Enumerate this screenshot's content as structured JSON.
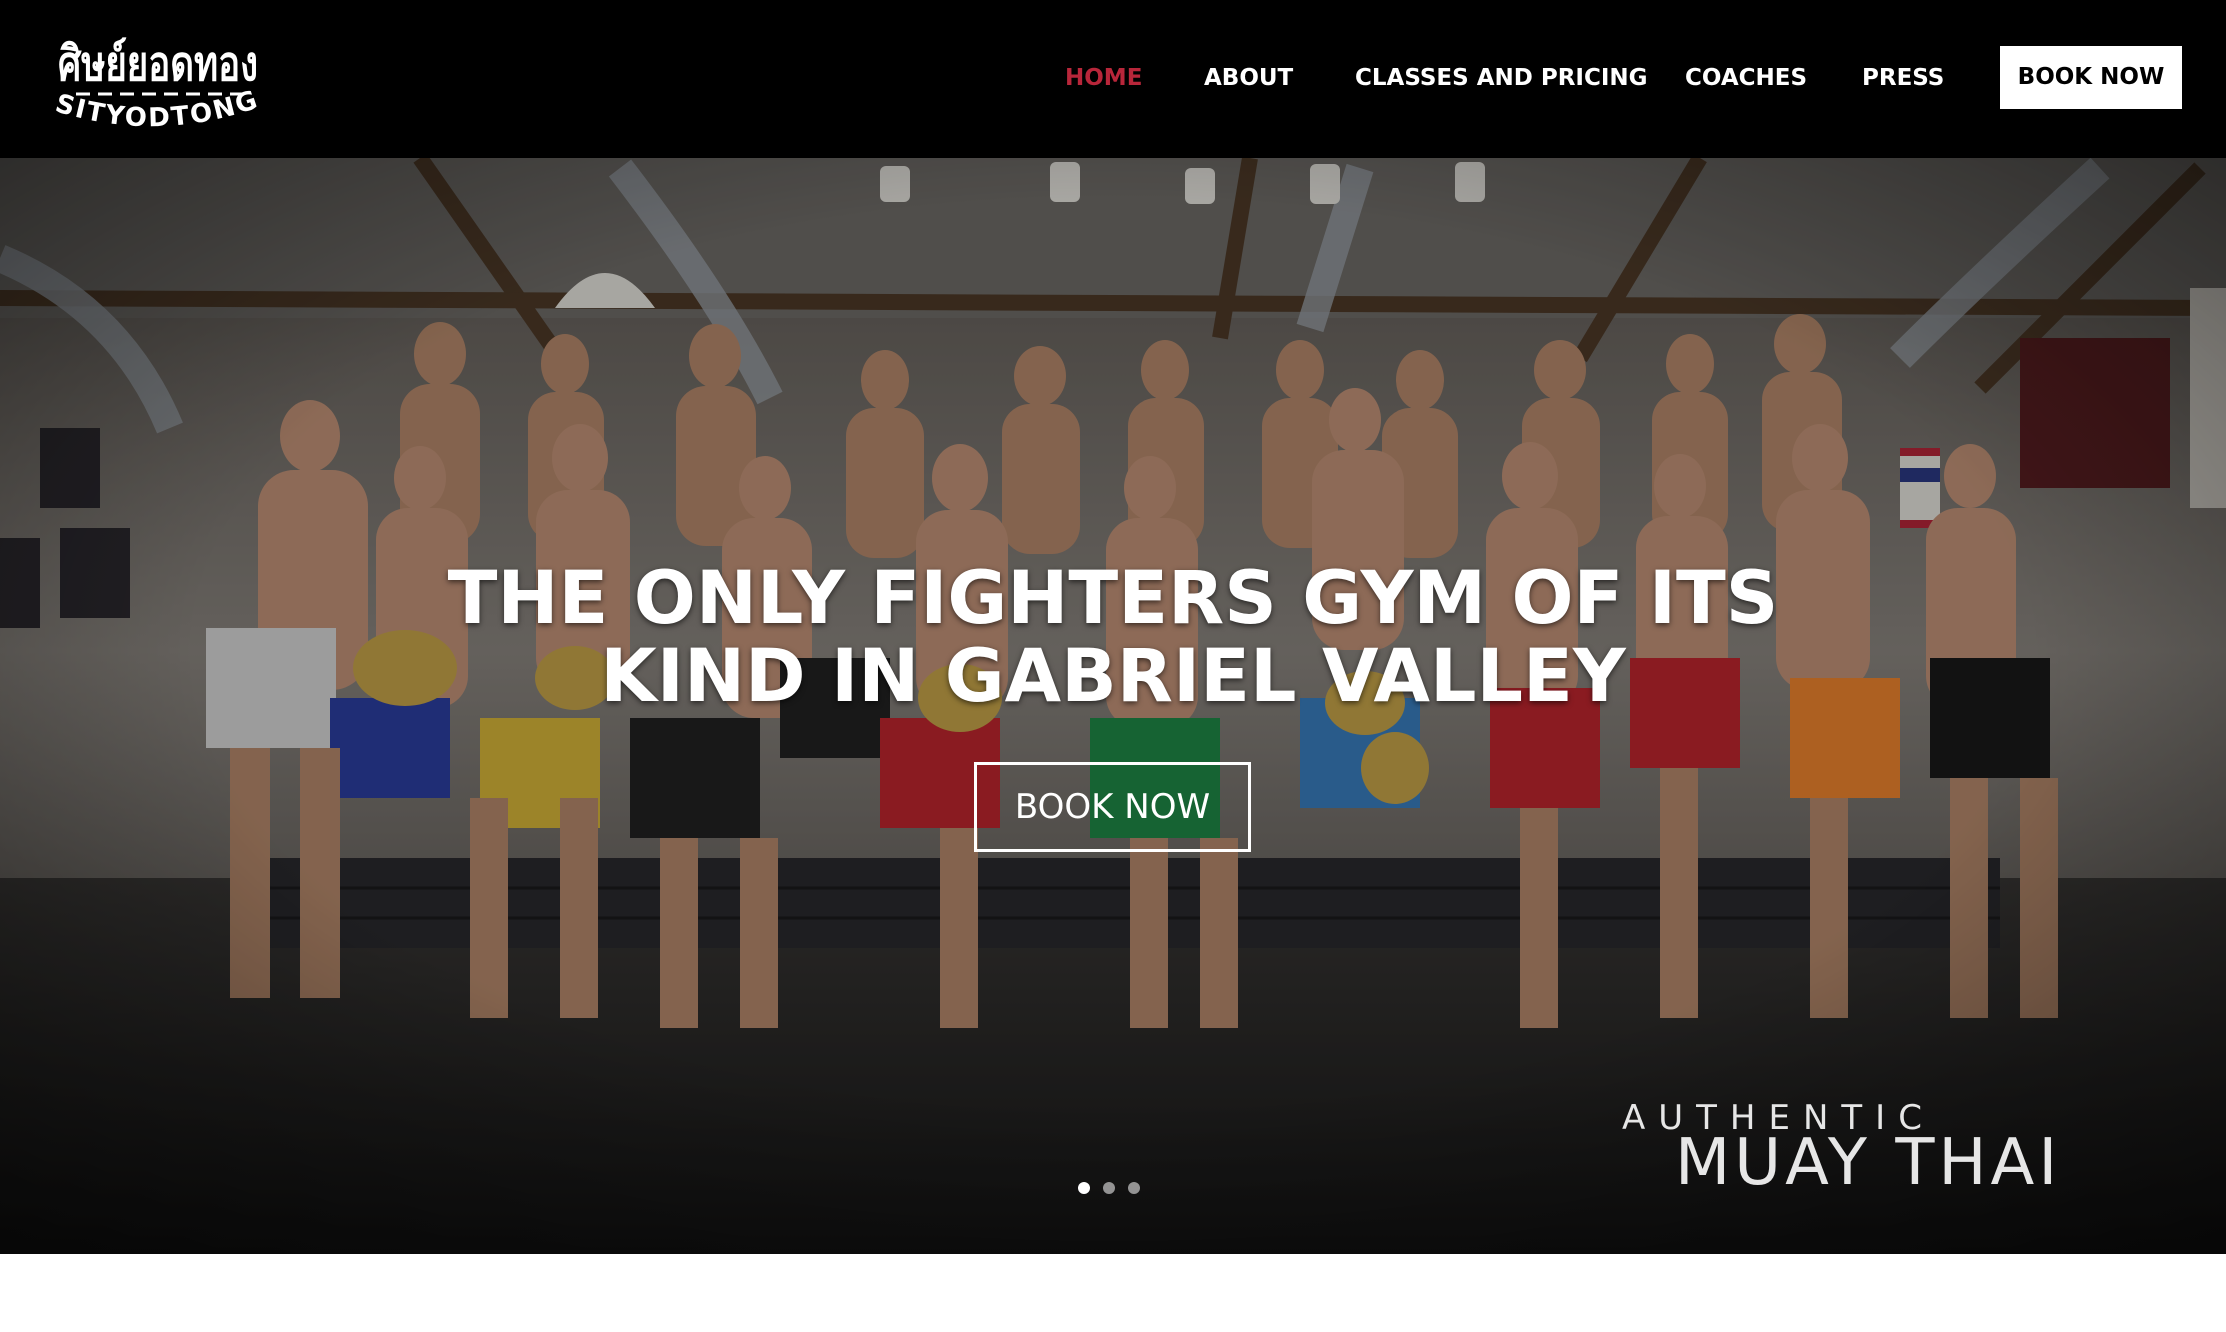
{
  "header": {
    "logo_text_thai": "ศิษย์ยอดทอง",
    "logo_text_latin": "SITYODTONG",
    "nav": [
      {
        "label": "HOME",
        "active": true
      },
      {
        "label": "ABOUT",
        "active": false
      },
      {
        "label": "CLASSES AND PRICING",
        "active": false
      },
      {
        "label": "COACHES",
        "active": false
      },
      {
        "label": "PRESS",
        "active": false
      }
    ],
    "book_button": "BOOK NOW",
    "active_color": "#b8263a"
  },
  "hero": {
    "headline_line1": "THE ONLY FIGHTERS GYM OF ITS",
    "headline_line2": "KIND IN GABRIEL VALLEY",
    "cta": "BOOK NOW",
    "watermark_line1": "AUTHENTIC",
    "watermark_line2": "MUAY THAI",
    "slides": {
      "count": 3,
      "active": 1
    }
  }
}
